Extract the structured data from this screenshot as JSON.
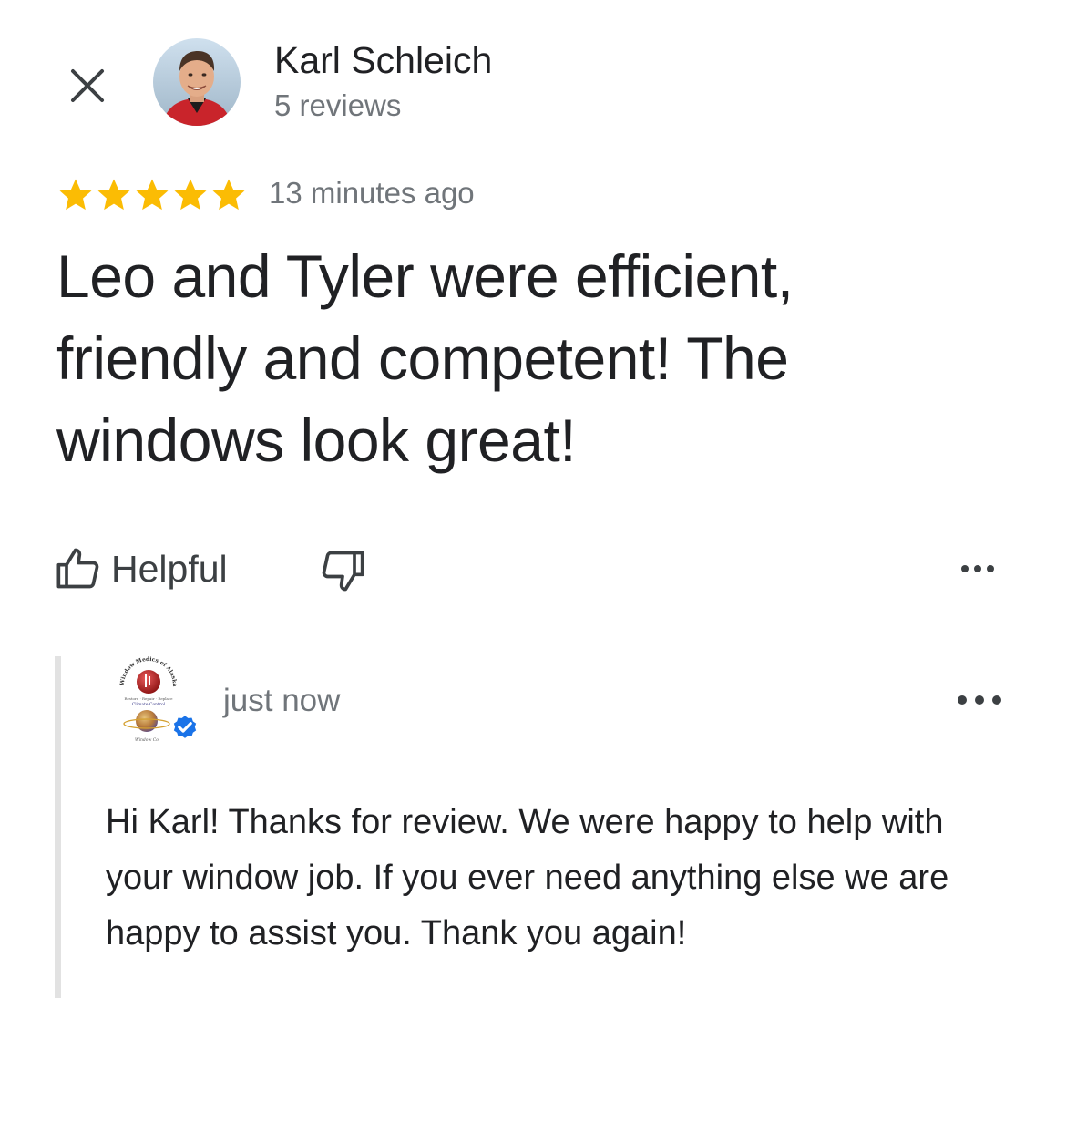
{
  "header": {
    "close_icon": "close-icon",
    "reviewer": {
      "name": "Karl Schleich",
      "review_count": "5 reviews",
      "avatar": "reviewer-avatar-photo"
    }
  },
  "review": {
    "rating": 5,
    "rating_max": 5,
    "star_color": "#fbbc04",
    "time": "13 minutes ago",
    "text": "Leo and Tyler were efficient,\nfriendly and competent!  The\nwindows look great!"
  },
  "actions": {
    "helpful_label": "Helpful",
    "helpful_icon": "thumbs-up-icon",
    "not_helpful_icon": "thumbs-down-icon",
    "more_icon": "more-horizontal-icon"
  },
  "owner_reply": {
    "logo": "window-medics-logo",
    "logo_text_top": "Window Medics of Alaska",
    "logo_text_middle": "Restore · Repair · Replace",
    "logo_text_lower": "Climate Control",
    "logo_text_bottom": "Window Co",
    "verified_icon": "verified-badge-icon",
    "verified_color": "#1a73e8",
    "time": "just now",
    "more_icon": "more-horizontal-icon",
    "text": "Hi Karl! Thanks for review. We were happy to help with your window job. If you ever need anything else we are happy to assist you. Thank you again!"
  }
}
